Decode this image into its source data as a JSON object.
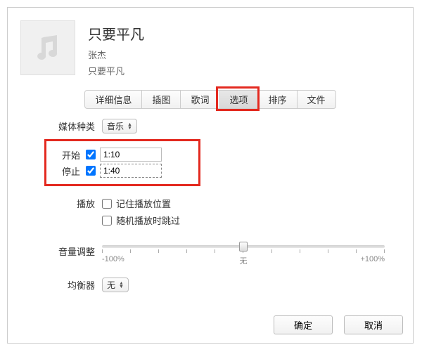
{
  "song": {
    "title": "只要平凡",
    "artist": "张杰",
    "album": "只要平凡"
  },
  "tabs": {
    "details": "详细信息",
    "artwork": "插图",
    "lyrics": "歌词",
    "options": "选项",
    "sorting": "排序",
    "file": "文件"
  },
  "labels": {
    "mediaKind": "媒体种类",
    "start": "开始",
    "stop": "停止",
    "playback": "播放",
    "remember": "记住播放位置",
    "skipShuffle": "随机播放时跳过",
    "volume": "音量调整",
    "eq": "均衡器"
  },
  "mediaKind": {
    "value": "音乐"
  },
  "start": {
    "checked": true,
    "value": "1:10"
  },
  "stop": {
    "checked": true,
    "value": "1:40"
  },
  "remember": {
    "checked": false
  },
  "skipShuffle": {
    "checked": false
  },
  "volume": {
    "min": "-100%",
    "center": "无",
    "max": "+100%"
  },
  "eq": {
    "value": "无"
  },
  "buttons": {
    "ok": "确定",
    "cancel": "取消"
  },
  "highlight": {
    "tab": "options"
  }
}
